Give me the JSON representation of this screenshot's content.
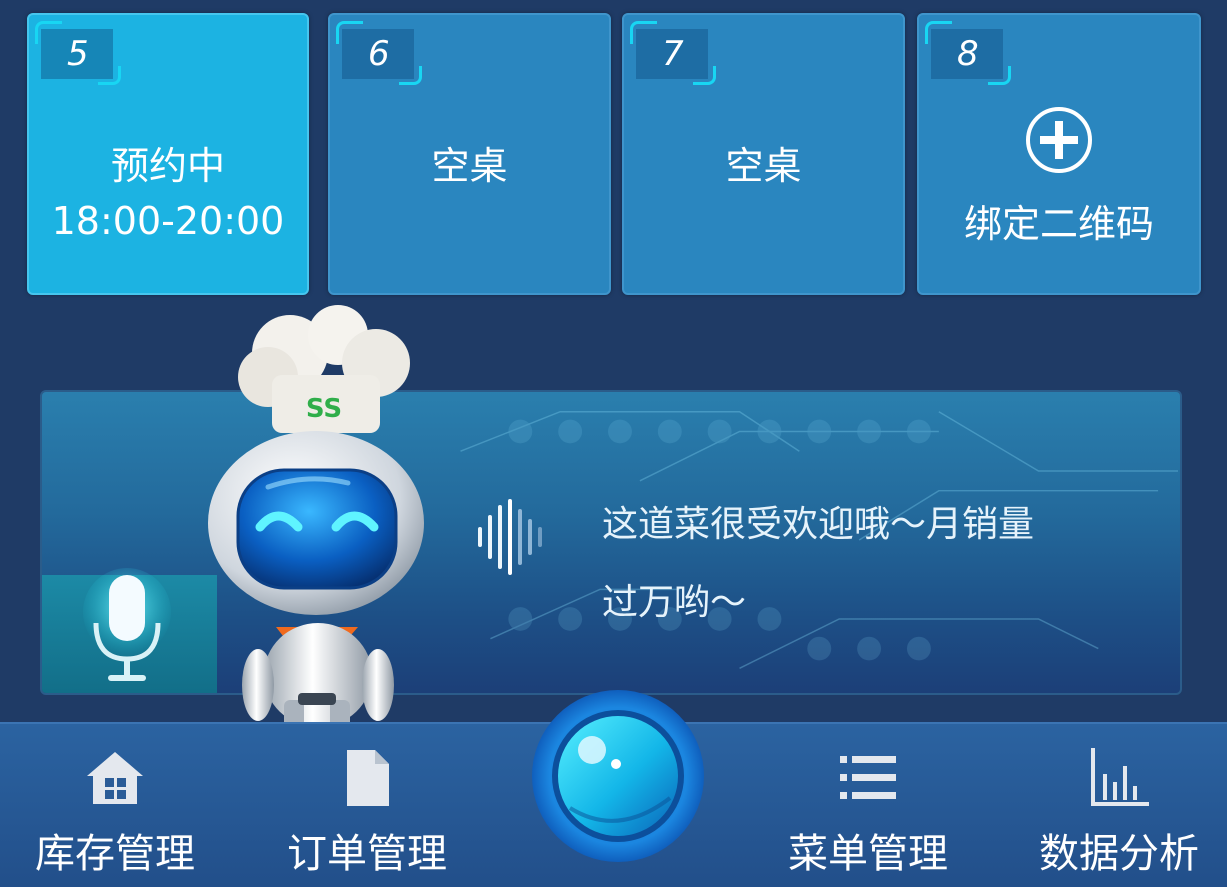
{
  "tables": [
    {
      "number": "5",
      "status": "预约中",
      "time": "18:00-20:00"
    },
    {
      "number": "6",
      "status": "空桌"
    },
    {
      "number": "7",
      "status": "空桌"
    },
    {
      "number": "8",
      "status": "绑定二维码",
      "icon": "plus-circle-icon"
    }
  ],
  "assistant": {
    "message_line1": "这道菜很受欢迎哦～月销量",
    "message_line2": "过万哟～",
    "hat_logo": "SS"
  },
  "bottom_nav": {
    "inventory": {
      "label": "库存管理",
      "icon": "home-icon"
    },
    "orders": {
      "label": "订单管理",
      "icon": "document-icon"
    },
    "menu": {
      "label": "菜单管理",
      "icon": "list-icon"
    },
    "analytics": {
      "label": "数据分析",
      "icon": "bar-chart-icon"
    },
    "center_button_icon": "voice-orb-icon"
  },
  "colors": {
    "background": "#1f3b66",
    "tile": "#2a86bf",
    "tile_reserved": "#1cb3e2",
    "accent": "#18d6f3",
    "nav_bar": "#2b63a1"
  }
}
